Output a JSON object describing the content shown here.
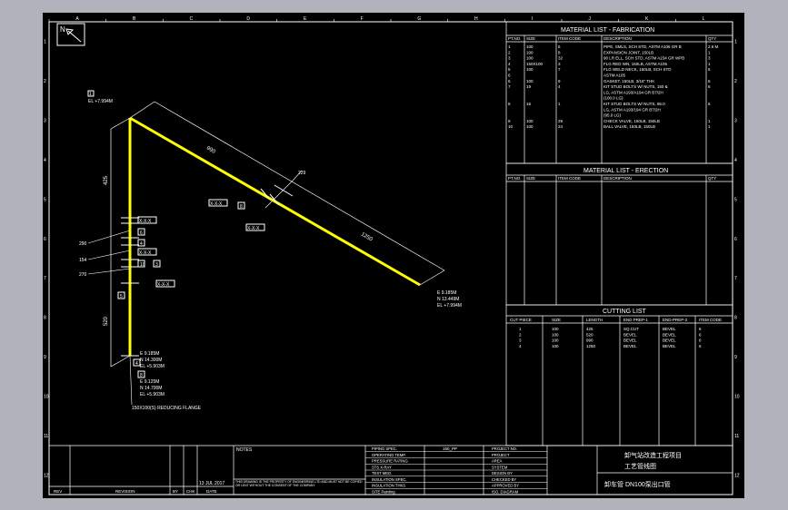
{
  "colors": {
    "background": "#000000",
    "canvas_frame": "#b0b3bc",
    "lines": "#ffffff",
    "pipe": "#ffff00"
  },
  "north": {
    "label": "N"
  },
  "border_marks": {
    "columns": [
      "A",
      "B",
      "C",
      "D",
      "E",
      "F",
      "G",
      "H",
      "I",
      "J",
      "K",
      "L"
    ],
    "rows": [
      "1",
      "2",
      "3",
      "4",
      "5",
      "6",
      "7",
      "8",
      "9",
      "10",
      "11",
      "12"
    ]
  },
  "material_fabrication": {
    "title": "MATERIAL LIST - FABRICATION",
    "headers": [
      "PT.NO.",
      "SIZE",
      "ITEM CODE",
      "DESCRIPTION",
      "QTY"
    ],
    "rows": [
      [
        "1",
        "100",
        "5",
        "PIPE, SMLS, SCH STD, ASTM A106 GR B",
        "2.6 M"
      ],
      [
        "2",
        "100",
        "8",
        "EXPANSION JOINT, 150LB",
        "1"
      ],
      [
        "3",
        "100",
        "32",
        "90 LR ELL, SCH STD, ASTM A234 GR WPB",
        "3"
      ],
      [
        "4",
        "150X100",
        "3",
        "FLG RED WN, 150LB, ASTM A105",
        "1"
      ],
      [
        "5",
        "100",
        "7",
        "FLG WELD NECK, 150LB, SCH STD",
        "6"
      ],
      [
        "6",
        "",
        "",
        "ASTM A105",
        ""
      ],
      [
        "6",
        "100",
        "9",
        "GASKET, 150LB, 3/16\" THK",
        "6"
      ],
      [
        "7",
        "19",
        "4",
        "KIT STUD BOLTS W/ NUTS, 150 &",
        "6"
      ],
      [
        "",
        "",
        "",
        "LG, ASTM A193/A194 GR B7/2H",
        ""
      ],
      [
        "",
        "",
        "",
        "(100.0 LG)",
        ""
      ],
      [
        "8",
        "16",
        "1",
        "KIT STUD BOLTS W/ NUTS, 95.0",
        "6"
      ],
      [
        "",
        "",
        "",
        "LG, ASTM A193/194 GR B7/2H",
        ""
      ],
      [
        "",
        "",
        "",
        "(95.0 LG)",
        ""
      ],
      [
        "9",
        "100",
        "29",
        "CHECK VALVE, 150LB, 150LB",
        "1"
      ],
      [
        "10",
        "100",
        "24",
        "BALL VALVE, 150LB, 150LB",
        "1"
      ]
    ]
  },
  "material_erection": {
    "title": "MATERIAL LIST - ERECTION",
    "headers": [
      "PT.NO.",
      "SIZE",
      "ITEM CODE",
      "DESCRIPTION",
      "QTY"
    ]
  },
  "cutting_list": {
    "title": "CUTTING LIST",
    "headers": [
      "CUT PIECE",
      "SIZE",
      "LENGTH",
      "END PREP-1",
      "END-PREP-2",
      "ITEM CODE"
    ],
    "rows": [
      [
        "1",
        "100",
        "425",
        "SQ.CUT",
        "BEVEL",
        "6"
      ],
      [
        "2",
        "100",
        "520",
        "BEVEL",
        "BEVEL",
        "6"
      ],
      [
        "3",
        "100",
        "990",
        "BEVEL",
        "BEVEL",
        "6"
      ],
      [
        "4",
        "100",
        "1250",
        "BEVEL",
        "BEVEL",
        "6"
      ]
    ]
  },
  "iso": {
    "top_flag": "1",
    "top_elev": "EL +7.994M",
    "end_coords": [
      "E 9.185M",
      "N 13.449M",
      "EL +7.994M"
    ],
    "bottom_coords_1": [
      "E 9.185M",
      "N 14.300M",
      "EL +5.903M"
    ],
    "bottom_coords_2": [
      "E 9.125M",
      "N 14.700M",
      "EL +5.903M"
    ],
    "reducing_flange_note": "150X100(S) REDUCING FLANGE",
    "dims": {
      "d1": "990",
      "d2": "1250",
      "d3": "425",
      "d4": "520",
      "d5": "290",
      "d6": "154",
      "d7": "270",
      "d8": "229"
    },
    "tags": [
      "X-X-X",
      "X-X-X",
      "X-X-X",
      "X-X-X",
      "X-X-X"
    ],
    "bubbles": [
      "8",
      "6",
      "4",
      "10",
      "3",
      "8",
      "4",
      "5"
    ]
  },
  "title_block": {
    "rev_headers": [
      "REV",
      "REVISION",
      "BY",
      "CHK",
      "DATE"
    ],
    "date": "13 JUL 2017",
    "notes_label": "NOTES",
    "disclaimer": "THIS DRAWING IS THE PROPERTY OF ENGINEERING LTD AND MUST NOT BE COPIED OR LENT WITHOUT THE CONSENT OF THE COMPANY",
    "spec_labels": [
      "PIPING SPEC.",
      "OPERATING TEMP.",
      "PRESSURE RATING",
      "STS X-RAY",
      "TEST MED.",
      "INSULATION SPEC.",
      "INSULATION THKS",
      "SITE Painting"
    ],
    "spec_values": [
      "150_PP",
      "",
      "",
      "",
      "",
      "",
      "",
      ""
    ],
    "project_labels": [
      "PROJECT NO.",
      "PROJECT",
      "AREA",
      "SYSTEM",
      "DESIGN BY",
      "CHECKED BY",
      "APPROVED BY",
      "ISO. DIAGRAM"
    ],
    "company_cn": "卸气站改造工程项目",
    "drawing_cn": "工艺管线图",
    "footer_cn": "卸车管 DN100泵出口管"
  }
}
